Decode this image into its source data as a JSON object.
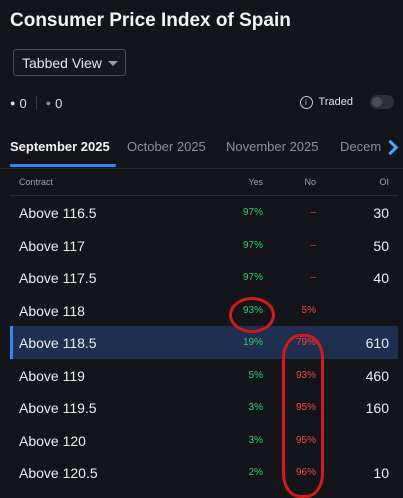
{
  "header": {
    "title": "Consumer Price Index of Spain"
  },
  "view_select": {
    "value": "Tabbed View"
  },
  "counts": {
    "first": "0",
    "second": "0"
  },
  "traded": {
    "label": "Traded",
    "enabled": false
  },
  "tabs": [
    {
      "label": "September 2025",
      "active": true
    },
    {
      "label": "October 2025",
      "active": false
    },
    {
      "label": "November 2025",
      "active": false
    },
    {
      "label": "Decem",
      "active": false
    }
  ],
  "table": {
    "headers": {
      "contract": "Contract",
      "yes": "Yes",
      "no": "No",
      "oi": "OI"
    },
    "rows": [
      {
        "contract": "Above 116.5",
        "yes": "97%",
        "no": "–",
        "oi": "30"
      },
      {
        "contract": "Above 117",
        "yes": "97%",
        "no": "–",
        "oi": "50"
      },
      {
        "contract": "Above 117.5",
        "yes": "97%",
        "no": "–",
        "oi": "40"
      },
      {
        "contract": "Above 118",
        "yes": "93%",
        "no": "5%",
        "oi": ""
      },
      {
        "contract": "Above 118.5",
        "yes": "19%",
        "no": "79%",
        "oi": "610"
      },
      {
        "contract": "Above 119",
        "yes": "5%",
        "no": "93%",
        "oi": "460"
      },
      {
        "contract": "Above 119.5",
        "yes": "3%",
        "no": "95%",
        "oi": "160"
      },
      {
        "contract": "Above 120",
        "yes": "3%",
        "no": "95%",
        "oi": ""
      },
      {
        "contract": "Above 120.5",
        "yes": "2%",
        "no": "96%",
        "oi": "10"
      }
    ]
  },
  "colors": {
    "accent": "#3b82f6",
    "yes": "#2ecc71",
    "no": "#ef4444",
    "annotation": "#d11b1b",
    "selected_row": "#1e2f4f"
  }
}
